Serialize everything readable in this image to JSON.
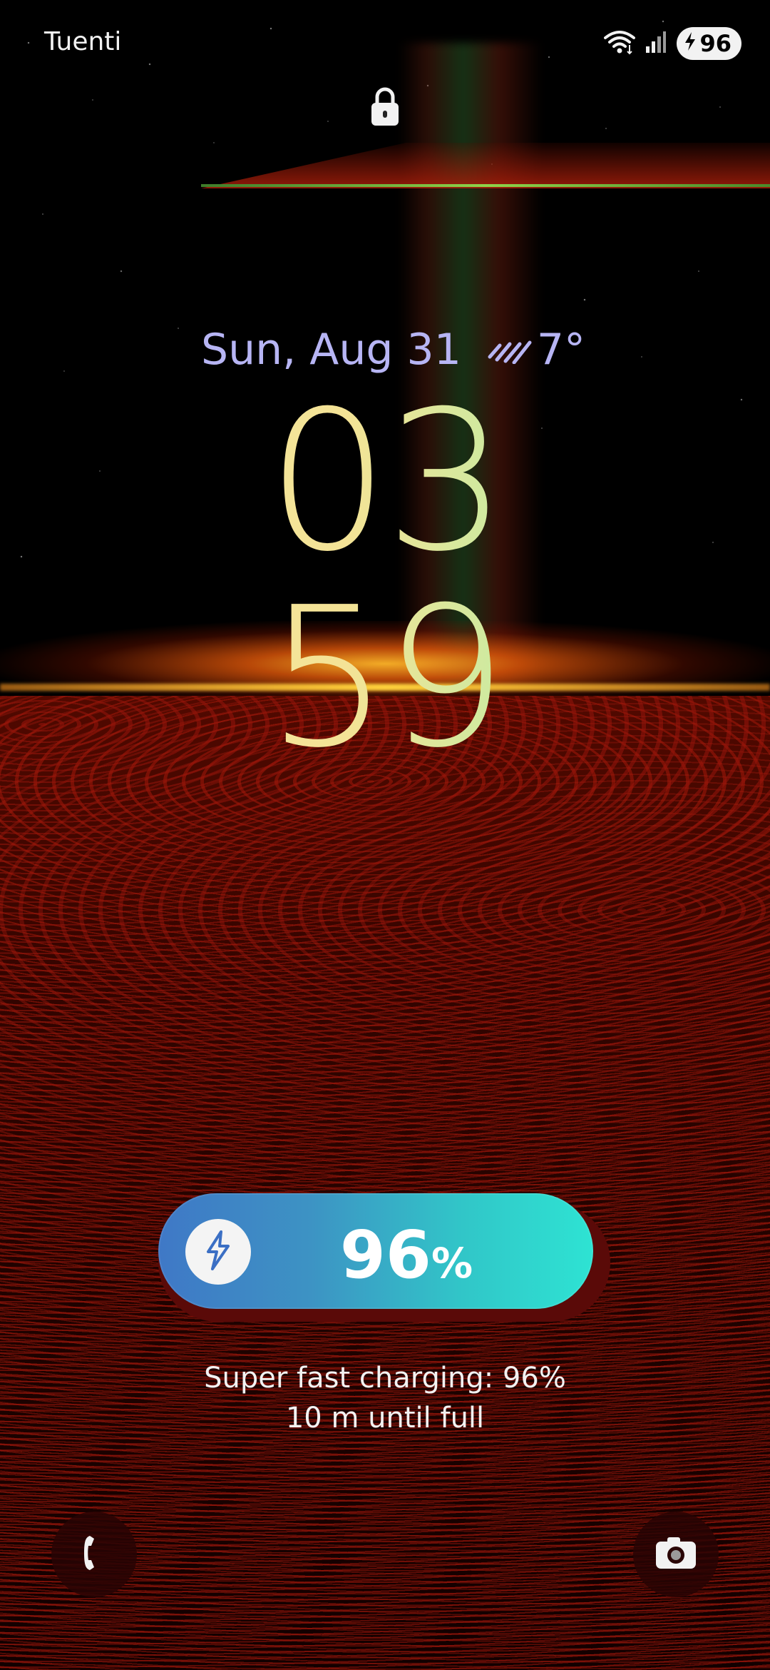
{
  "status_bar": {
    "carrier": "Tuenti",
    "battery_level": "96",
    "icons": [
      "wifi-icon",
      "signal-icon",
      "charging-bolt-icon"
    ]
  },
  "lock": {
    "icon": "lock-icon"
  },
  "date": "Sun, Aug 31",
  "weather": {
    "icon": "rain-icon",
    "temperature": "7°"
  },
  "clock": {
    "hours": "03",
    "minutes": "59"
  },
  "charging": {
    "level_number": "96",
    "level_unit": "%",
    "level_fraction": 0.96,
    "status_line": "Super fast charging: 96%",
    "time_line": "10 m until full",
    "icon": "charging-bolt-icon"
  },
  "shortcuts": {
    "left": {
      "icon": "phone-icon"
    },
    "right": {
      "icon": "camera-icon"
    }
  },
  "colors": {
    "date_text": "#b7b5f4",
    "clock_gradient_start": "#f7e7a2",
    "clock_gradient_end": "#a8e5b5",
    "charge_gradient_start": "#3f78c6",
    "charge_gradient_end": "#2ee3d3"
  }
}
